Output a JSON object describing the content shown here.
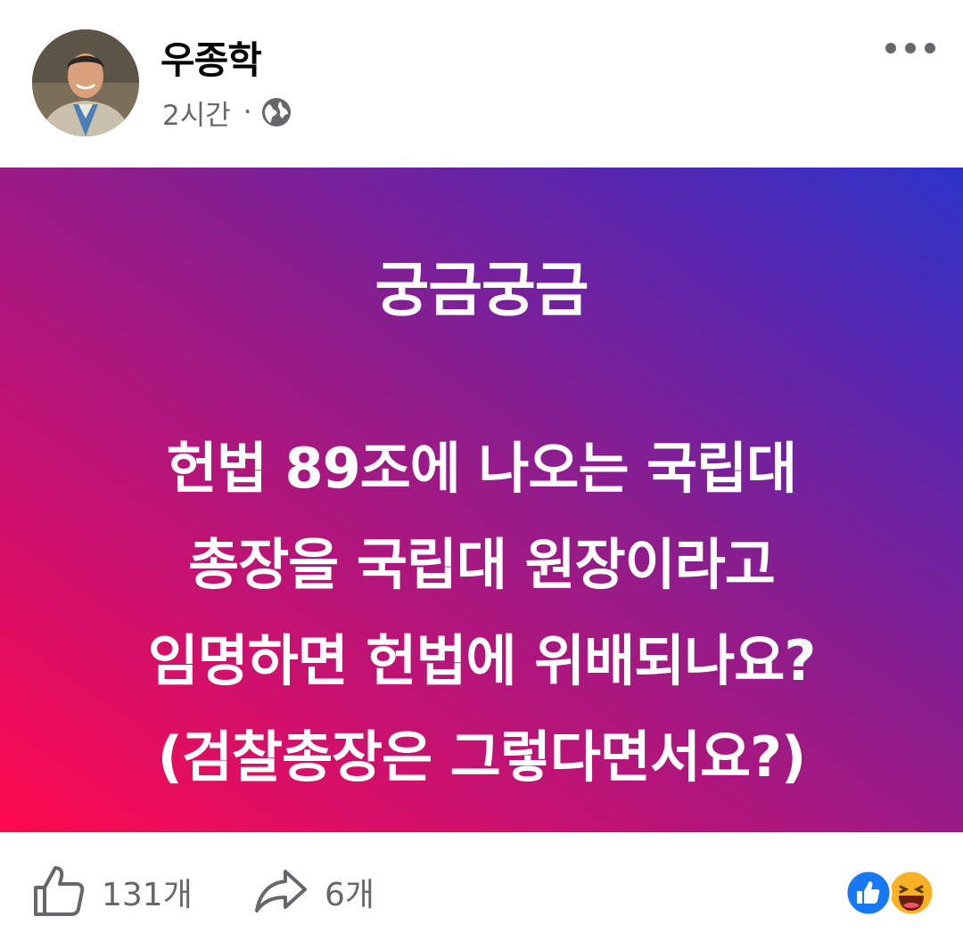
{
  "header": {
    "author_name": "우종학",
    "time_ago": "2시간",
    "separator": "·",
    "privacy_icon": "globe-icon",
    "more_icon": "more-options-icon"
  },
  "post": {
    "title": "궁금궁금",
    "body_lines": [
      "헌법 89조에 나오는 국립대",
      "총장을 국립대 원장이라고",
      "임명하면 헌법에 위배되나요?",
      "(검찰총장은 그렇다면서요?)"
    ],
    "background_colors": [
      "#ff0a4e",
      "#2d33c8"
    ]
  },
  "footer": {
    "like_count": "131개",
    "share_count": "6개",
    "like_icon": "thumbs-up-icon",
    "share_icon": "share-arrow-icon",
    "reaction_icons": [
      "like-reaction-icon",
      "haha-reaction-icon"
    ]
  }
}
